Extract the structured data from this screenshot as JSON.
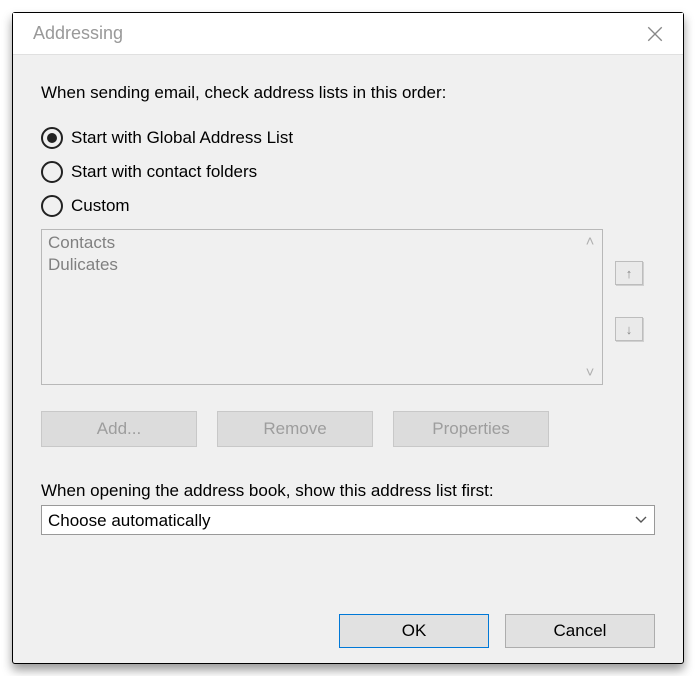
{
  "window": {
    "title": "Addressing"
  },
  "section1": {
    "label": "When sending email, check address lists in this order:"
  },
  "radios": {
    "opt0": {
      "label": "Start with Global Address List",
      "selected": true
    },
    "opt1": {
      "label": "Start with contact folders",
      "selected": false
    },
    "opt2": {
      "label": "Custom",
      "selected": false
    }
  },
  "listbox": {
    "items": [
      "Contacts",
      "Dulicates"
    ]
  },
  "moveButtons": {
    "up": "↥",
    "down": "↧"
  },
  "actions": {
    "add": "Add...",
    "remove": "Remove",
    "properties": "Properties"
  },
  "section2": {
    "label": "When opening the address book, show this address list first:"
  },
  "dropdown": {
    "value": "Choose automatically"
  },
  "buttons": {
    "ok": "OK",
    "cancel": "Cancel"
  }
}
